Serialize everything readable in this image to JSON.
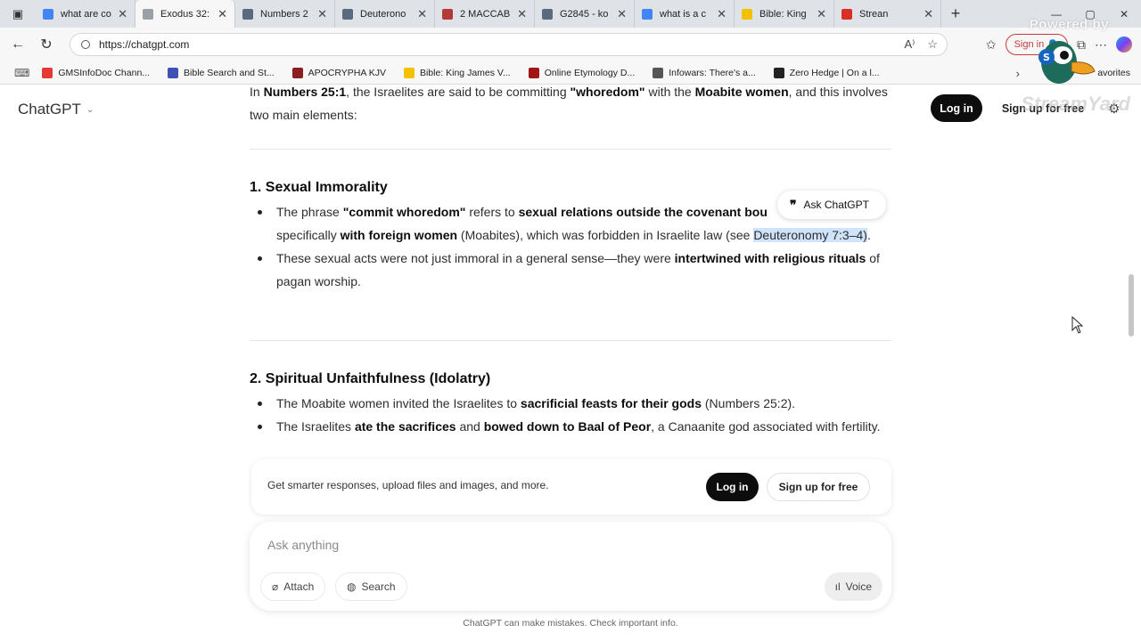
{
  "browser": {
    "tabs": [
      {
        "title": "what are co",
        "color": "#4285f4",
        "active": false
      },
      {
        "title": "Exodus 32:",
        "color": "#9aa0a6",
        "active": true
      },
      {
        "title": "Numbers 2",
        "color": "#5b6b7f",
        "active": false
      },
      {
        "title": "Deuterono",
        "color": "#5b6b7f",
        "active": false
      },
      {
        "title": "2 MACCAB",
        "color": "#b33a3a",
        "active": false
      },
      {
        "title": "G2845 - ko",
        "color": "#5b6b7f",
        "active": false
      },
      {
        "title": "what is a c",
        "color": "#4285f4",
        "active": false
      },
      {
        "title": "Bible: King",
        "color": "#f2c200",
        "active": false
      },
      {
        "title": "Strean",
        "color": "#d93025",
        "active": false
      }
    ],
    "new_tab": "+",
    "url": "https://chatgpt.com",
    "signin": "Sign in",
    "bookmarks": [
      {
        "label": "GMSInfoDoc Chann...",
        "color": "#e53935"
      },
      {
        "label": "Bible Search and St...",
        "color": "#3f51b5"
      },
      {
        "label": "APOCRYPHA KJV",
        "color": "#8b1e1e"
      },
      {
        "label": "Bible: King James V...",
        "color": "#f2c200"
      },
      {
        "label": "Online Etymology D...",
        "color": "#a31515"
      },
      {
        "label": "Infowars: There's a...",
        "color": "#555555"
      },
      {
        "label": "Zero Hedge | On a l...",
        "color": "#222222"
      }
    ],
    "favorites": "avorites",
    "watermark": "Powered by",
    "watermark2": "StreamYard"
  },
  "app": {
    "brand": "ChatGPT",
    "login": "Log in",
    "signup": "Sign up for free"
  },
  "article": {
    "intro_a": "In ",
    "intro_b": "Numbers 25:1",
    "intro_c": ", the Israelites are said to be committing ",
    "intro_d": "\"whoredom\"",
    "intro_e": " with the ",
    "intro_f": "Moabite women",
    "intro_g": ", and this involves two main elements:",
    "s1_title": "1. Sexual Immorality",
    "s1_b1_a": "The phrase ",
    "s1_b1_b": "\"commit whoredom\"",
    "s1_b1_c": " refers to ",
    "s1_b1_d": "sexual relations outside the covenant bou",
    "s1_b1_e": "specifically ",
    "s1_b1_f": "with foreign women",
    "s1_b1_g": " (Moabites), which was forbidden in Israelite law (see ",
    "s1_b1_h": "Deuteronomy 7:3–4)",
    "s1_b1_i": ".",
    "s1_b2_a": "These sexual acts were not just immoral in a general sense—they were ",
    "s1_b2_b": "intertwined with religious rituals",
    "s1_b2_c": " of pagan worship.",
    "s2_title": "2. Spiritual Unfaithfulness (Idolatry)",
    "s2_b1_a": "The Moabite women invited the Israelites to ",
    "s2_b1_b": "sacrificial feasts for their gods",
    "s2_b1_c": " (Numbers 25:2).",
    "s2_b2_a": "The Israelites ",
    "s2_b2_b": "ate the sacrifices",
    "s2_b2_c": " and ",
    "s2_b2_d": "bowed down to Baal of Peor",
    "s2_b2_e": ", a Canaanite god associated with fertility."
  },
  "ask_popup": "Ask ChatGPT",
  "banner": {
    "text": "Get smarter responses, upload files and images, and more.",
    "login": "Log in",
    "signup": "Sign up for free"
  },
  "composer": {
    "placeholder": "Ask anything",
    "attach": "Attach",
    "search": "Search",
    "voice": "Voice"
  },
  "footer": "ChatGPT can make mistakes. Check important info."
}
